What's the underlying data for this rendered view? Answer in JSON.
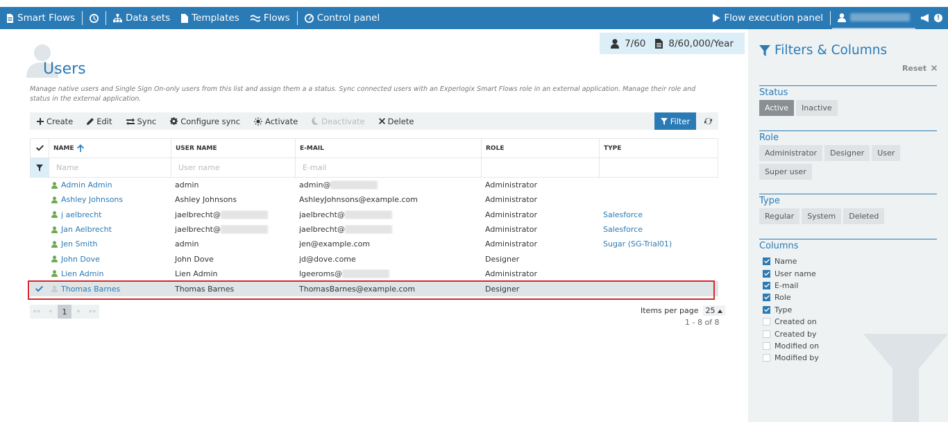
{
  "nav": {
    "brand": "Smart Flows",
    "datasets": "Data sets",
    "templates": "Templates",
    "flows": "Flows",
    "control_panel": "Control panel",
    "flow_execution_panel": "Flow execution panel",
    "notification_count": "!"
  },
  "usage": {
    "users": "7/60",
    "documents": "8/60,000/Year"
  },
  "page": {
    "title": "Users",
    "description": "Manage native users and Single Sign On-only users from this list and assign them a a status. Sync connected users with an Experlogix Smart Flows role in an external application. Manage their role and status in the external application."
  },
  "toolbar": {
    "create": "Create",
    "edit": "Edit",
    "sync": "Sync",
    "configure_sync": "Configure sync",
    "activate": "Activate",
    "deactivate": "Deactivate",
    "delete": "Delete",
    "filter": "Filter"
  },
  "table": {
    "headers": {
      "name": "NAME",
      "username": "USER NAME",
      "email": "E-MAIL",
      "role": "ROLE",
      "type": "TYPE"
    },
    "filter_placeholders": {
      "name": "Name",
      "username": "User name",
      "email": "E-mail"
    },
    "rows": [
      {
        "name": "Admin Admin",
        "username": "admin",
        "email": "admin@",
        "role": "Administrator",
        "type": ""
      },
      {
        "name": "Ashley Johnsons",
        "username": "Ashley Johnsons",
        "email": "AshleyJohnsons@example.com",
        "role": "Administrator",
        "type": ""
      },
      {
        "name": "j aelbrecht",
        "username": "jaelbrecht@",
        "email": "jaelbrecht@",
        "role": "Administrator",
        "type": "Salesforce"
      },
      {
        "name": "Jan Aelbrecht",
        "username": "jaelbrecht@",
        "email": "jaelbrecht@",
        "role": "Administrator",
        "type": "Salesforce"
      },
      {
        "name": "Jen Smith",
        "username": "admin",
        "email": "jen@example.com",
        "role": "Administrator",
        "type": "Sugar (SG-Trial01)"
      },
      {
        "name": "John Dove",
        "username": "John Dove",
        "email": "jd@dove.come",
        "role": "Designer",
        "type": ""
      },
      {
        "name": "Lien Admin",
        "username": "Lien Admin",
        "email": "lgeeroms@",
        "role": "Administrator",
        "type": ""
      },
      {
        "name": "Thomas Barnes",
        "username": "Thomas Barnes",
        "email": "ThomasBarnes@example.com",
        "role": "Designer",
        "type": ""
      }
    ]
  },
  "pager": {
    "first": "««",
    "prev": "«",
    "current": "1",
    "next": "»",
    "last": "»»",
    "items_per_page_label": "Items per page",
    "items_per_page": "25",
    "range": "1 - 8 of 8"
  },
  "panel": {
    "title": "Filters & Columns",
    "reset": "Reset",
    "status_label": "Status",
    "status": [
      "Active",
      "Inactive"
    ],
    "role_label": "Role",
    "roles": [
      "Administrator",
      "Designer",
      "User",
      "Super user"
    ],
    "type_label": "Type",
    "types": [
      "Regular",
      "System",
      "Deleted"
    ],
    "columns_label": "Columns",
    "columns": [
      {
        "label": "Name",
        "checked": true
      },
      {
        "label": "User name",
        "checked": true
      },
      {
        "label": "E-mail",
        "checked": true
      },
      {
        "label": "Role",
        "checked": true
      },
      {
        "label": "Type",
        "checked": true
      },
      {
        "label": "Created on",
        "checked": false
      },
      {
        "label": "Created by",
        "checked": false
      },
      {
        "label": "Modified on",
        "checked": false
      },
      {
        "label": "Modified by",
        "checked": false
      }
    ]
  },
  "colors": {
    "primary": "#2a7ab5",
    "user_active": "#6aa84f",
    "selection_outline": "#d9252b"
  }
}
